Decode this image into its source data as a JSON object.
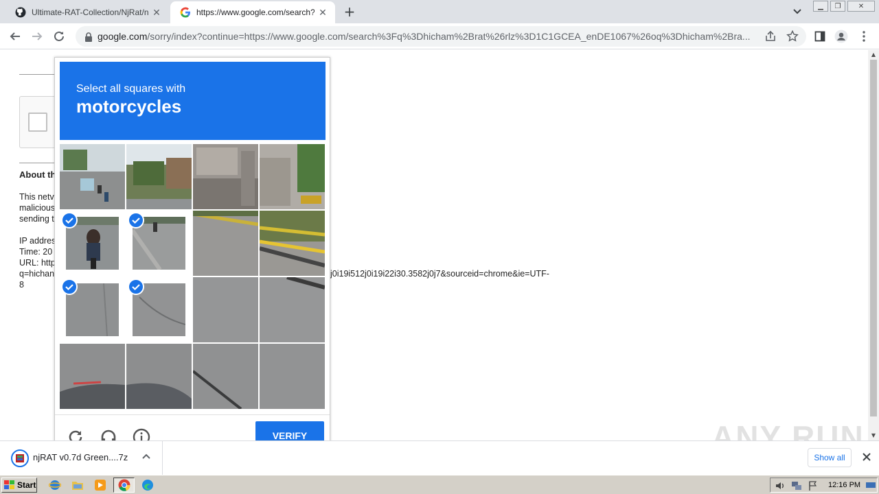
{
  "browser": {
    "tabs": [
      {
        "title": "Ultimate-RAT-Collection/NjRat/njRAT",
        "favicon": "github-icon",
        "active": false
      },
      {
        "title": "https://www.google.com/search?q=",
        "favicon": "google-icon",
        "active": true
      }
    ],
    "new_tab_label": "+",
    "url_host": "google.com",
    "url_rest": "/sorry/index?continue=https://www.google.com/search%3Fq%3Dhicham%2Brat%26rlz%3D1C1GCEA_enDE1067%26oq%3Dhicham%2Bra..."
  },
  "page": {
    "about_heading": "About th",
    "lines": [
      "This netv",
      "malicious",
      "sending t",
      "",
      "IP addres",
      "Time: 20",
      "URL: http",
      "q=hichan",
      "8"
    ],
    "url_tail": "j0i19i512j0i19i22i30.3582j0j7&sourceid=chrome&ie=UTF-"
  },
  "captcha": {
    "instruction": "Select all squares with",
    "target": "motorcycles",
    "verify_label": "VERIFY",
    "selected_tiles": [
      4,
      5,
      8,
      9
    ],
    "accent": "#1a73e8"
  },
  "downloads": {
    "file_name": "njRAT v0.7d Green....7z",
    "show_all_label": "Show all"
  },
  "watermark": "ANY RUN",
  "taskbar": {
    "start_label": "Start",
    "clock": "12:16 PM"
  }
}
